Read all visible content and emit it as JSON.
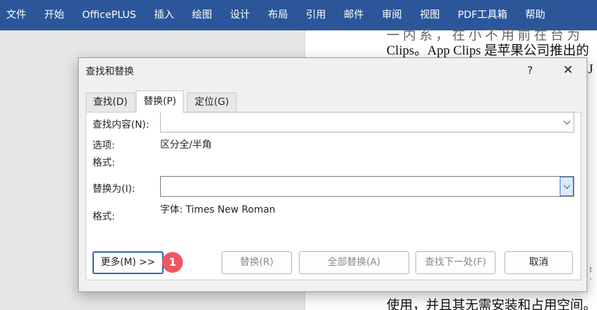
{
  "ribbon": {
    "tabs": [
      "文件",
      "开始",
      "OfficePLUS",
      "插入",
      "绘图",
      "设计",
      "布局",
      "引用",
      "邮件",
      "审阅",
      "视图",
      "PDF工具箱",
      "帮助"
    ]
  },
  "document": {
    "line_top": "一 内 系 ， 在 小 不 用 前 在 台 为",
    "line_1": "Clips。App Clips 是苹果公司推出的",
    "line_2": "J",
    "line_bottom": "使用，并且其无需安装和占用空间。",
    "side_text": "t -"
  },
  "dialog": {
    "title": "查找和替换",
    "help_glyph": "?",
    "close_glyph": "✕",
    "tabs": {
      "find": "查找(D)",
      "replace": "替换(P)",
      "goto": "定位(G)"
    },
    "find_label": "查找内容(N):",
    "find_value": "",
    "options_label": "选项:",
    "options_value": "区分全/半角",
    "format_label_1": "格式:",
    "replace_label": "替换为(I):",
    "replace_value": "",
    "format_label_2": "格式:",
    "format_value_2": "字体: Times New Roman",
    "buttons": {
      "more": "更多(M) >>",
      "replace": "替换(R)",
      "replace_all": "全部替换(A)",
      "find_next": "查找下一处(F)",
      "cancel": "取消"
    },
    "badge": "1"
  },
  "colors": {
    "ribbon_bg": "#2b579a",
    "badge": "#f25563",
    "focus_blue": "#2a62b8"
  }
}
